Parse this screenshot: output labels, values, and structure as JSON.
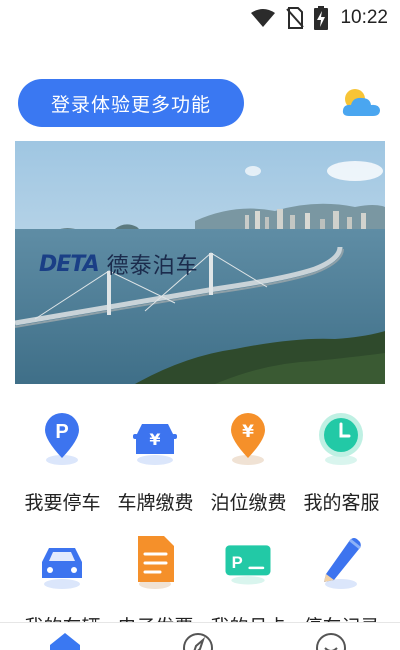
{
  "status_bar": {
    "time": "10:22",
    "icons": [
      "wifi-icon",
      "no-sim-icon",
      "battery-charging-icon"
    ]
  },
  "header": {
    "login_label": "登录体验更多功能",
    "weather_icon": "partly-cloudy-icon"
  },
  "banner": {
    "logo_text": "DETA",
    "brand_name": "德泰泊车"
  },
  "grid": [
    {
      "label": "我要停车",
      "icon": "parking-pin-icon"
    },
    {
      "label": "车牌缴费",
      "icon": "car-yen-icon"
    },
    {
      "label": "泊位缴费",
      "icon": "yen-pin-icon"
    },
    {
      "label": "我的客服",
      "icon": "clock-icon"
    },
    {
      "label": "我的车辆",
      "icon": "car-icon"
    },
    {
      "label": "电子发票",
      "icon": "invoice-icon"
    },
    {
      "label": "我的月卡",
      "icon": "parking-card-icon"
    },
    {
      "label": "停车记录",
      "icon": "pencil-icon"
    }
  ],
  "bottom_nav": [
    "home-icon",
    "compass-icon",
    "profile-icon"
  ],
  "colors": {
    "accent": "#3a78f2",
    "orange": "#f5902a",
    "teal": "#22c9a6"
  }
}
